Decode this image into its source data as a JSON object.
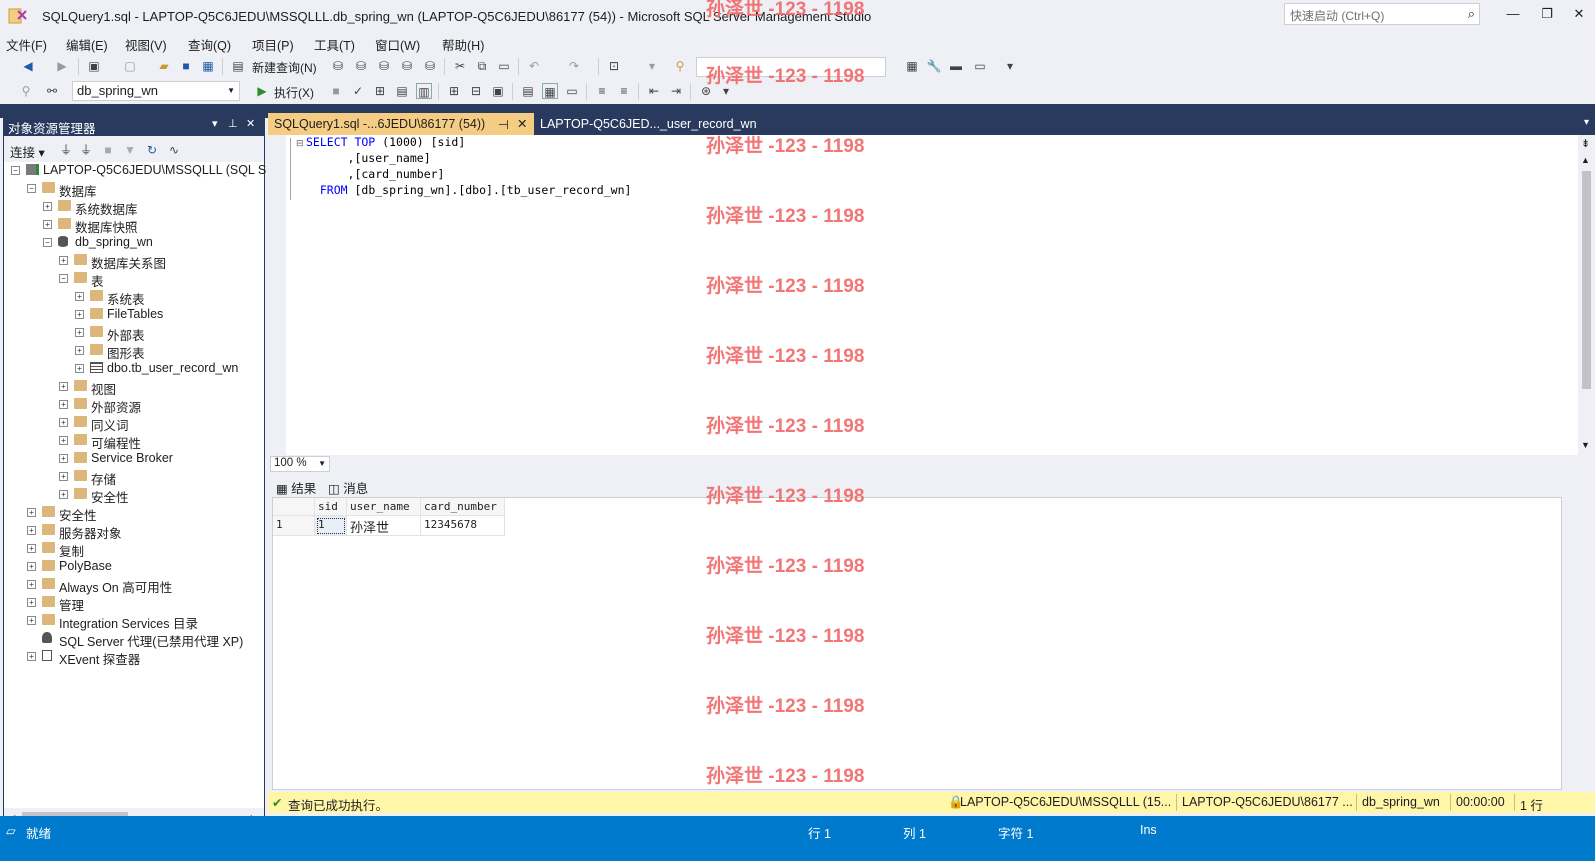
{
  "window": {
    "title": "SQLQuery1.sql - LAPTOP-Q5C6JEDU\\MSSQLLL.db_spring_wn (LAPTOP-Q5C6JEDU\\86177 (54)) - Microsoft SQL Server Management Studio",
    "quick_launch_placeholder": "快速启动 (Ctrl+Q)"
  },
  "menu": [
    "文件(F)",
    "编辑(E)",
    "视图(V)",
    "查询(Q)",
    "项目(P)",
    "工具(T)",
    "窗口(W)",
    "帮助(H)"
  ],
  "toolbar": {
    "new_query_label": "新建查询(N)",
    "database": "db_spring_wn",
    "execute_label": "执行(X)"
  },
  "object_explorer": {
    "title": "对象资源管理器",
    "connect_label": "连接 ▾",
    "tree": [
      {
        "label": "LAPTOP-Q5C6JEDU\\MSSQLLL (SQL S",
        "expanded": true,
        "icon": "server-icon"
      },
      {
        "label": "数据库",
        "expanded": true,
        "icon": "folder-icon"
      },
      {
        "label": "系统数据库",
        "expanded": false,
        "icon": "folder-icon"
      },
      {
        "label": "数据库快照",
        "expanded": false,
        "icon": "folder-icon"
      },
      {
        "label": "db_spring_wn",
        "expanded": true,
        "icon": "database-icon"
      },
      {
        "label": "数据库关系图",
        "expanded": false,
        "icon": "folder-icon"
      },
      {
        "label": "表",
        "expanded": true,
        "icon": "folder-icon"
      },
      {
        "label": "系统表",
        "expanded": false,
        "icon": "folder-icon"
      },
      {
        "label": "FileTables",
        "expanded": false,
        "icon": "folder-icon"
      },
      {
        "label": "外部表",
        "expanded": false,
        "icon": "folder-icon"
      },
      {
        "label": "图形表",
        "expanded": false,
        "icon": "folder-icon"
      },
      {
        "label": "dbo.tb_user_record_wn",
        "expanded": false,
        "icon": "table-icon"
      },
      {
        "label": "视图",
        "expanded": false,
        "icon": "folder-icon"
      },
      {
        "label": "外部资源",
        "expanded": false,
        "icon": "folder-icon"
      },
      {
        "label": "同义词",
        "expanded": false,
        "icon": "folder-icon"
      },
      {
        "label": "可编程性",
        "expanded": false,
        "icon": "folder-icon"
      },
      {
        "label": "Service Broker",
        "expanded": false,
        "icon": "folder-icon"
      },
      {
        "label": "存储",
        "expanded": false,
        "icon": "folder-icon"
      },
      {
        "label": "安全性",
        "expanded": false,
        "icon": "folder-icon"
      },
      {
        "label": "安全性",
        "expanded": false,
        "icon": "folder-icon"
      },
      {
        "label": "服务器对象",
        "expanded": false,
        "icon": "folder-icon"
      },
      {
        "label": "复制",
        "expanded": false,
        "icon": "folder-icon"
      },
      {
        "label": "PolyBase",
        "expanded": false,
        "icon": "folder-icon"
      },
      {
        "label": "Always On 高可用性",
        "expanded": false,
        "icon": "folder-icon"
      },
      {
        "label": "管理",
        "expanded": false,
        "icon": "folder-icon"
      },
      {
        "label": "Integration Services 目录",
        "expanded": false,
        "icon": "folder-icon"
      },
      {
        "label": "SQL Server 代理(已禁用代理 XP)",
        "expanded": null,
        "icon": "agent-icon"
      },
      {
        "label": "XEvent 探查器",
        "expanded": false,
        "icon": "xevent-icon"
      }
    ]
  },
  "tabs": [
    {
      "label": "SQLQuery1.sql -...6JEDU\\86177 (54))",
      "active": true
    },
    {
      "label": "LAPTOP-Q5C6JED..._user_record_wn",
      "active": false
    }
  ],
  "editor": {
    "lines": [
      {
        "kw": "SELECT TOP",
        "rest": " (1000) [sid]"
      },
      {
        "kw": "",
        "rest": "      ,[user_name]"
      },
      {
        "kw": "",
        "rest": "      ,[card_number]"
      },
      {
        "kw": "  FROM",
        "rest": " [db_spring_wn].[dbo].[tb_user_record_wn]"
      }
    ],
    "zoom": "100 %"
  },
  "results": {
    "tabs": [
      "结果",
      "消息"
    ],
    "columns": [
      "sid",
      "user_name",
      "card_number"
    ],
    "rows": [
      {
        "num": "1",
        "cells": [
          "1",
          "孙泽世",
          "12345678"
        ]
      }
    ]
  },
  "query_status": {
    "message": "查询已成功执行。",
    "server": "LAPTOP-Q5C6JEDU\\MSSQLLL (15...",
    "user": "LAPTOP-Q5C6JEDU\\86177 ...",
    "database": "db_spring_wn",
    "elapsed": "00:00:00",
    "rows": "1 行"
  },
  "status": {
    "ready": "就绪",
    "line": "行 1",
    "col": "列 1",
    "char": "字符 1",
    "mode": "Ins"
  },
  "watermark": "孙泽世 -123 - 1198",
  "colors": {
    "accent_blue": "#007acc",
    "dark_navy": "#2a3a5f",
    "tab_active": "#f5cc84",
    "status_yellow": "#fff6a8",
    "watermark_red": "#f26a6a"
  }
}
